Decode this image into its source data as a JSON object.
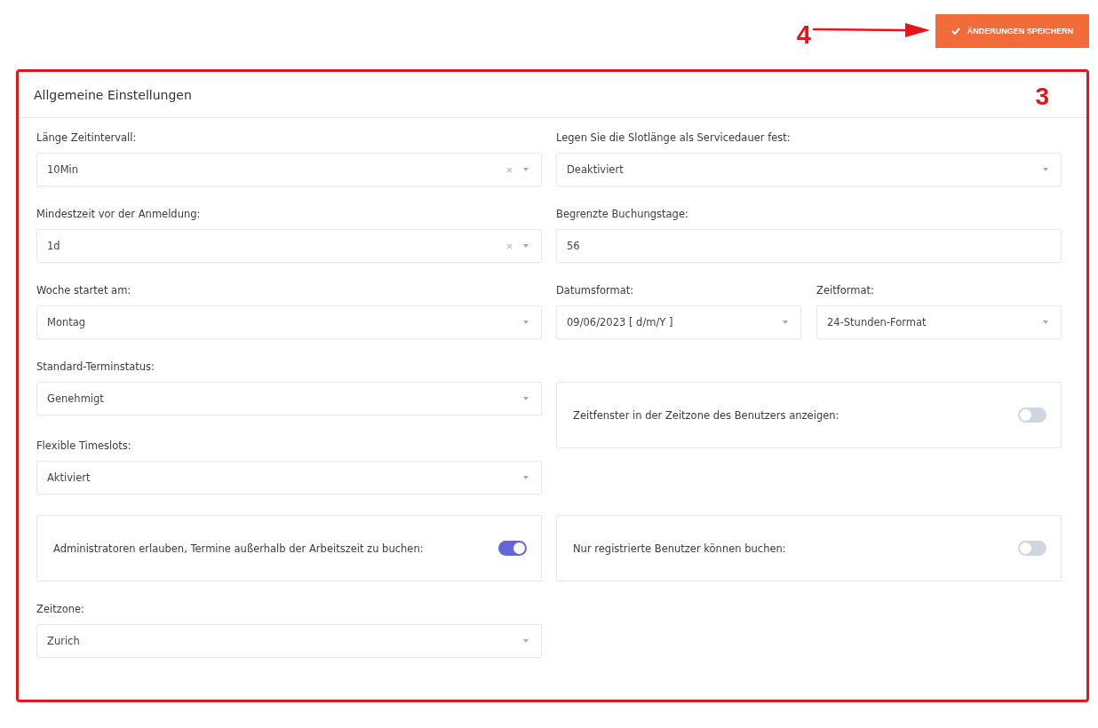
{
  "save_button": {
    "label": "ÄNDERUNGEN SPEICHERN"
  },
  "annotations": [
    {
      "label": "4"
    },
    {
      "label": "3"
    }
  ],
  "card": {
    "title": "Allgemeine Einstellungen"
  },
  "rows": [
    {
      "cells": [
        {
          "kind": "select",
          "label": "Länge Zeitintervall:",
          "value": "10Min",
          "clearable": true
        },
        {
          "kind": "select",
          "label": "Legen Sie die Slotlänge als Servicedauer fest:",
          "value": "Deaktiviert",
          "clearable": false
        }
      ]
    },
    {
      "cells": [
        {
          "kind": "select",
          "label": "Mindestzeit vor der Anmeldung:",
          "value": "1d",
          "clearable": true
        },
        {
          "kind": "input",
          "label": "Begrenzte Buchungstage:",
          "value": "56"
        }
      ]
    },
    {
      "cells": [
        {
          "kind": "select",
          "label": "Woche startet am:",
          "value": "Montag",
          "clearable": false
        },
        {
          "kind": "pair",
          "fields": [
            {
              "label": "Datumsformat:",
              "value": "09/06/2023 [ d/m/Y ]",
              "clearable": false
            },
            {
              "label": "Zeitformat:",
              "value": "24-Stunden-Format",
              "clearable": false
            }
          ]
        }
      ]
    },
    {
      "cells": [
        {
          "kind": "select",
          "label": "Standard-Terminstatus:",
          "value": "Genehmigt",
          "clearable": false
        },
        {
          "kind": "toggle",
          "label": "Zeitfenster in der Zeitzone des Benutzers anzeigen:",
          "on": false
        }
      ]
    },
    {
      "cells": [
        {
          "kind": "select",
          "label": "Flexible Timeslots:",
          "value": "Aktiviert",
          "clearable": false
        }
      ]
    },
    {
      "cells": [
        {
          "kind": "toggle",
          "label": "Administratoren erlauben, Termine außerhalb der Arbeitszeit zu buchen:",
          "on": true
        },
        {
          "kind": "toggle",
          "label": "Nur registrierte Benutzer können buchen:",
          "on": false
        }
      ]
    },
    {
      "cells": [
        {
          "kind": "select",
          "label": "Zeitzone:",
          "value": "Zurich",
          "clearable": false
        }
      ]
    }
  ]
}
